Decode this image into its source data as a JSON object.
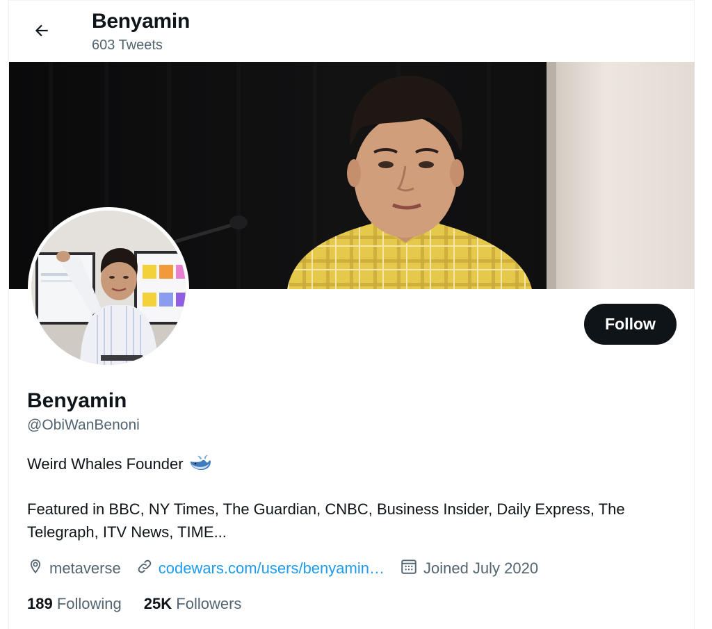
{
  "header": {
    "name": "Benyamin",
    "tweet_count": "603 Tweets",
    "back_icon": "arrow-left-icon"
  },
  "profile": {
    "display_name": "Benyamin",
    "handle": "@ObiWanBenoni",
    "follow_label": "Follow",
    "bio_line1": "Weird Whales Founder",
    "bio_emoji": "whale-icon",
    "bio_line2": "Featured in BBC, NY Times, The Guardian, CNBC, Business Insider, Daily Express, The Telegraph, ITV News, TIME..."
  },
  "meta": {
    "location": "metaverse",
    "location_icon": "location-pin-icon",
    "website": "codewars.com/users/benyamin…",
    "website_icon": "link-icon",
    "joined": "Joined July 2020",
    "joined_icon": "calendar-icon"
  },
  "stats": {
    "following_count": "189",
    "following_label": "Following",
    "followers_count": "25K",
    "followers_label": "Followers"
  },
  "colors": {
    "accent": "#1d9bf0",
    "text_primary": "#0f1419",
    "text_secondary": "#536471",
    "follow_bg": "#0f1419"
  }
}
